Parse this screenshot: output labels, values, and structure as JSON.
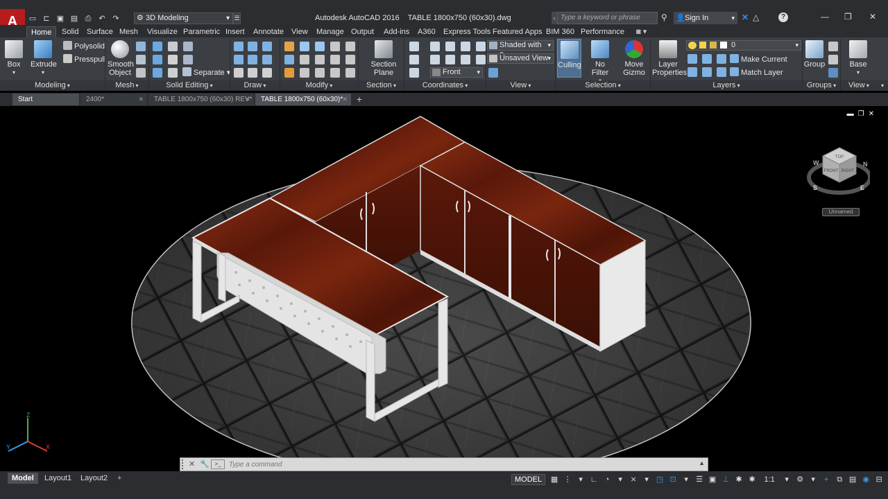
{
  "titlebar": {
    "app_logo": "A",
    "workspace": "3D Modeling",
    "title": "Autodesk AutoCAD 2016    TABLE 1800x750 (60x30).dwg",
    "search_placeholder": "Type a keyword or phrase",
    "sign_in": "Sign In"
  },
  "ribbon_tabs": [
    "Home",
    "Solid",
    "Surface",
    "Mesh",
    "Visualize",
    "Parametric",
    "Insert",
    "Annotate",
    "View",
    "Manage",
    "Output",
    "Add-ins",
    "A360",
    "Express Tools",
    "Featured Apps",
    "BIM 360",
    "Performance"
  ],
  "ribbon": {
    "modeling": {
      "box": "Box",
      "extrude": "Extrude",
      "polysolid": "Polysolid",
      "presspull": "Presspull",
      "footer": "Modeling"
    },
    "mesh": {
      "smooth_object_1": "Smooth",
      "smooth_object_2": "Object",
      "footer": "Mesh"
    },
    "solid_editing": {
      "separate": "Separate",
      "footer": "Solid Editing"
    },
    "draw": {
      "footer": "Draw"
    },
    "modify": {
      "footer": "Modify"
    },
    "section": {
      "plane_1": "Section",
      "plane_2": "Plane",
      "footer": "Section"
    },
    "coordinates": {
      "footer": "Coordinates"
    },
    "view": {
      "visual_style": "Shaded with e...",
      "named_view": "Unsaved View",
      "view_direction": "Front",
      "footer": "View"
    },
    "selection": {
      "culling": "Culling",
      "no_filter": "No Filter",
      "move_gizmo_1": "Move",
      "move_gizmo_2": "Gizmo",
      "footer": "Selection"
    },
    "layers": {
      "layer_properties_1": "Layer",
      "layer_properties_2": "Properties",
      "current_layer": "0",
      "make_current": "Make Current",
      "match_layer": "Match Layer",
      "footer": "Layers"
    },
    "groups": {
      "group": "Group",
      "footer": "Groups"
    },
    "view2": {
      "base": "Base",
      "footer": "View"
    }
  },
  "doc_tabs": [
    {
      "label": "Start"
    },
    {
      "label": "2400*"
    },
    {
      "label": "TABLE 1800x750 (60x30) REV*"
    },
    {
      "label": "TABLE 1800x750 (60x30)*"
    }
  ],
  "viewcube": {
    "top": "TOP",
    "front": "FRONT",
    "right": "RIGHT",
    "compass_n": "N",
    "compass_w": "W",
    "compass_s": "S",
    "compass_e": "E",
    "ucs_label": "Unnamed"
  },
  "ucs": {
    "x": "X",
    "y": "Y",
    "z": "Z"
  },
  "command_line": {
    "placeholder": "Type a command"
  },
  "layout_tabs": [
    "Model",
    "Layout1",
    "Layout2"
  ],
  "status": {
    "model": "MODEL",
    "scale": "1:1"
  },
  "colors": {
    "wood": "#6a1c0a",
    "frame": "#e8e8e8",
    "floor": "#3a3a3a",
    "accent": "#3d9be9",
    "logo_red": "#b81c1c"
  }
}
